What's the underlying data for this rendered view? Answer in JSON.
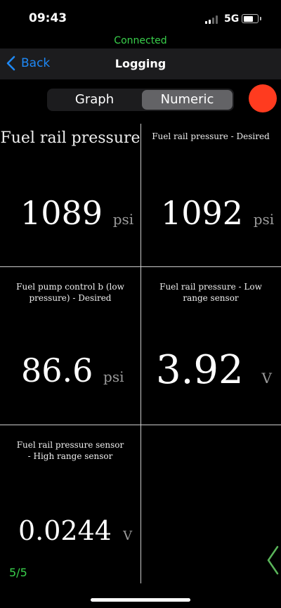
{
  "status": {
    "time": "09:43",
    "network": "5G",
    "connection": "Connected"
  },
  "nav": {
    "back_label": "Back",
    "title": "Logging"
  },
  "segments": {
    "graph": "Graph",
    "numeric": "Numeric",
    "selected": "Numeric"
  },
  "readings": [
    {
      "label": "Fuel rail pressure",
      "value": "1089",
      "unit": "psi"
    },
    {
      "label": "Fuel rail pressure  -  Desired",
      "value": "1092",
      "unit": "psi"
    },
    {
      "label": "Fuel pump control b (low pressure)  -  Desired",
      "value": "86.6",
      "unit": "psi"
    },
    {
      "label": "Fuel rail pressure  -  Low range sensor",
      "value": "3.92",
      "unit": "V"
    },
    {
      "label": "Fuel rail pressure sensor  -  High range sensor",
      "value": "0.0244",
      "unit": "V"
    }
  ],
  "pagination": {
    "page": "5/5"
  },
  "colors": {
    "connected": "#39d04b",
    "record": "#ff3b1f",
    "link": "#1e88f5"
  }
}
